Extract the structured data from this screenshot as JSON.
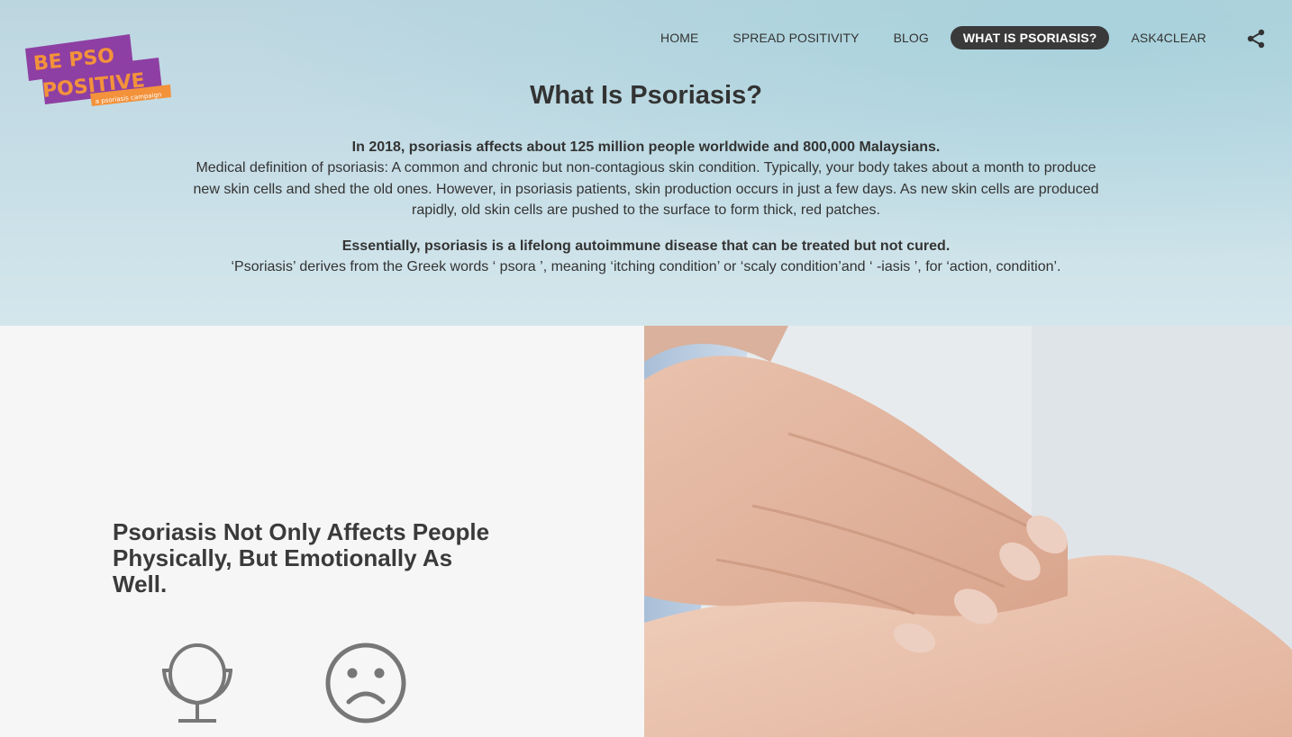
{
  "brand": {
    "logo_line1": "BE PSO",
    "logo_line2": "POSITIVE",
    "tagline": "a psoriasis campaign",
    "colors": {
      "purple": "#8e3fa3",
      "orange": "#f3923b"
    }
  },
  "nav": {
    "items": [
      {
        "label": "HOME",
        "active": false
      },
      {
        "label": "SPREAD POSITIVITY",
        "active": false
      },
      {
        "label": "BLOG",
        "active": false
      },
      {
        "label": "WHAT IS PSORIASIS?",
        "active": true
      },
      {
        "label": "ASK4CLEAR",
        "active": false
      }
    ],
    "share_icon": "share-icon"
  },
  "hero": {
    "title": "What Is Psoriasis?",
    "stat": "In 2018, psoriasis affects about 125 million people worldwide and 800,000 Malaysians.",
    "definition": "Medical definition of psoriasis: A common and chronic but non-contagious skin condition. Typically, your body takes about a month to produce new skin cells and shed the old ones. However, in psoriasis patients, skin production occurs in just a few days. As new skin cells are produced rapidly, old skin cells are pushed to the surface to form thick, red patches.",
    "essential": "Essentially, psoriasis is a lifelong autoimmune disease that can be treated but not cured.",
    "etymology": "‘Psoriasis’ derives from the Greek words ‘ psora ’, meaning ‘itching condition’ or ‘scaly condition’and ‘ -iasis ’, for ‘action, condition’."
  },
  "section": {
    "heading": "Psoriasis Not Only Affects People Physically, But Emotionally As Well.",
    "icons": [
      "mirror-icon",
      "sad-face-icon"
    ],
    "photo": "hands-holding-wrist-photo"
  }
}
